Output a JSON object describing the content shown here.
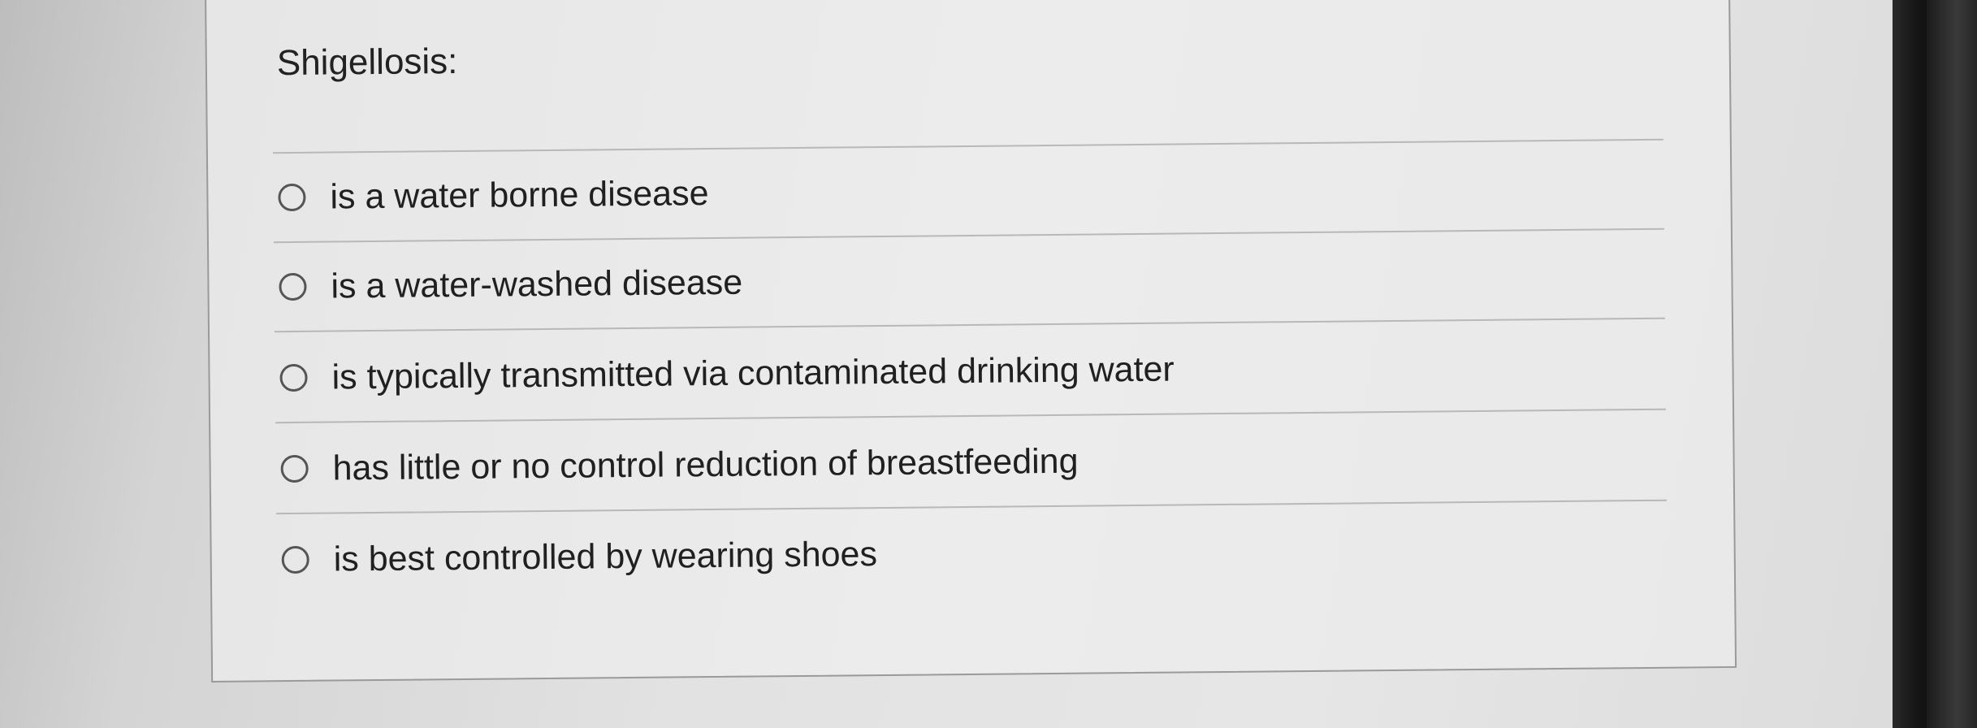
{
  "question": {
    "text": "Shigellosis:"
  },
  "options": [
    {
      "label": "is a water borne disease",
      "selected": false
    },
    {
      "label": "is a water-washed disease",
      "selected": false
    },
    {
      "label": "is typically transmitted via contaminated drinking water",
      "selected": false
    },
    {
      "label": "has little or no control reduction of breastfeeding",
      "selected": false
    },
    {
      "label": "is best controlled by wearing shoes",
      "selected": false
    }
  ],
  "colors": {
    "text": "#222222",
    "radio_border": "#555555",
    "divider": "#b8b8b8",
    "card_border": "#9a9a9a"
  }
}
